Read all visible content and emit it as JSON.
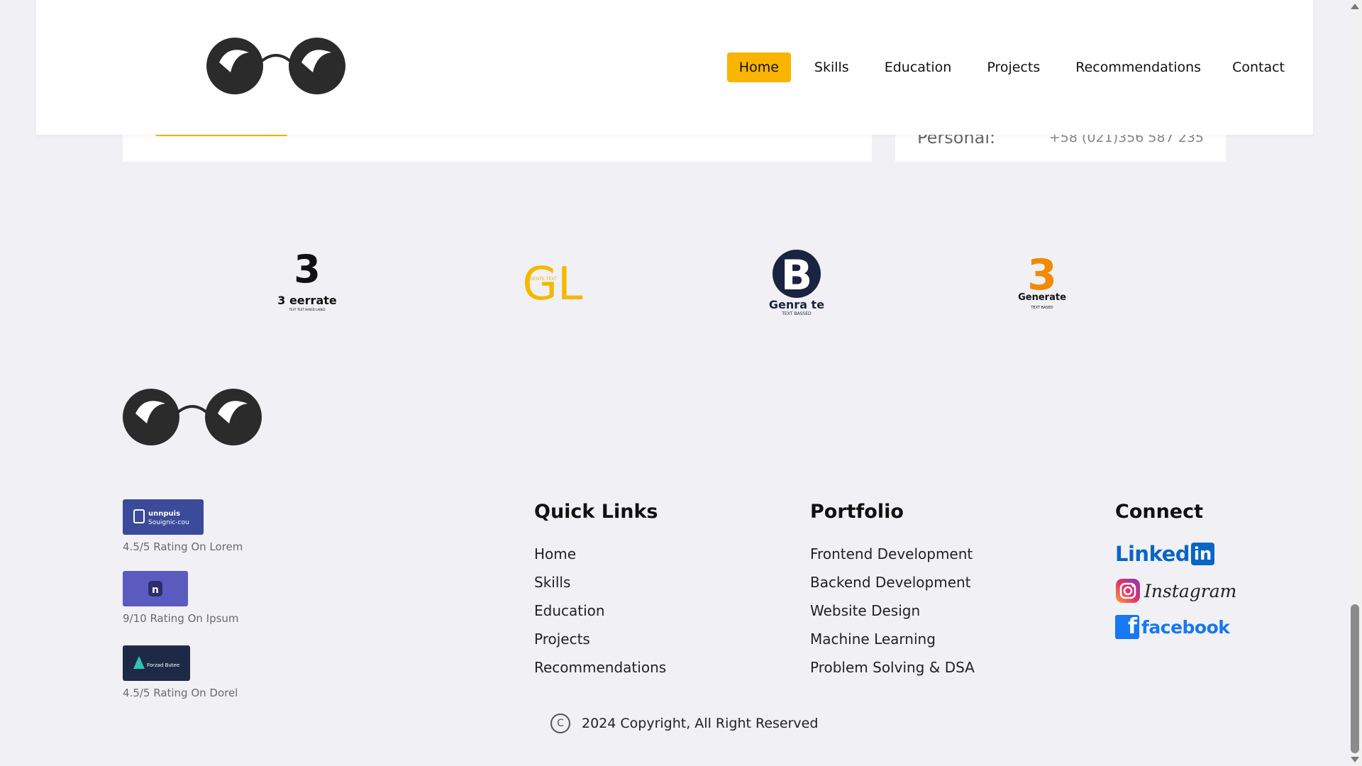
{
  "header": {
    "logo_icon": "glasses-icon",
    "nav": [
      "Home",
      "Skills",
      "Education",
      "Projects",
      "Recommendations",
      "Contact"
    ],
    "active_nav": "Home"
  },
  "contact_card": {
    "label": "Personal:",
    "value": "+58 (021)356 587 235"
  },
  "partners": [
    {
      "name": "3 eerrate",
      "subtitle": "TEXT TEXT BASED LABED",
      "color": "#111111"
    },
    {
      "name": "GL",
      "subtitle": "GENTE TEXT",
      "color": "#f5b800"
    },
    {
      "name": "Genra te",
      "subtitle": "TEXT BASSED",
      "color": "#1a2340"
    },
    {
      "name": "Generate",
      "subtitle": "TEXT BASED",
      "color": "#f08a00"
    }
  ],
  "ratings": [
    {
      "badge_text": "Unnpuis Souignic-cou",
      "caption": "4.5/5 Rating On Lorem",
      "color": "#3b4a9a"
    },
    {
      "badge_text": "n",
      "caption": "9/10 Rating On Ipsum",
      "color": "#5b5bbf"
    },
    {
      "badge_text": "Forzad Butee",
      "caption": "4.5/5 Rating On Dorel",
      "color": "#1e2a45"
    }
  ],
  "quick_links": {
    "title": "Quick Links",
    "items": [
      "Home",
      "Skills",
      "Education",
      "Projects",
      "Recommendations"
    ]
  },
  "portfolio": {
    "title": "Portfolio",
    "items": [
      "Frontend Development",
      "Backend Development",
      "Website Design",
      "Machine Learning",
      "Problem Solving & DSA"
    ]
  },
  "connect": {
    "title": "Connect",
    "linkedin": "Linked",
    "linkedin_box": "in",
    "instagram": "Instagram",
    "facebook": "facebook",
    "colors": {
      "linkedin": "#0a66c2",
      "facebook": "#1877f2"
    }
  },
  "copyright": {
    "icon": "copyright-icon",
    "symbol": "C",
    "text": "2024 Copyright, All Right Reserved"
  },
  "accent": "#f8b400"
}
